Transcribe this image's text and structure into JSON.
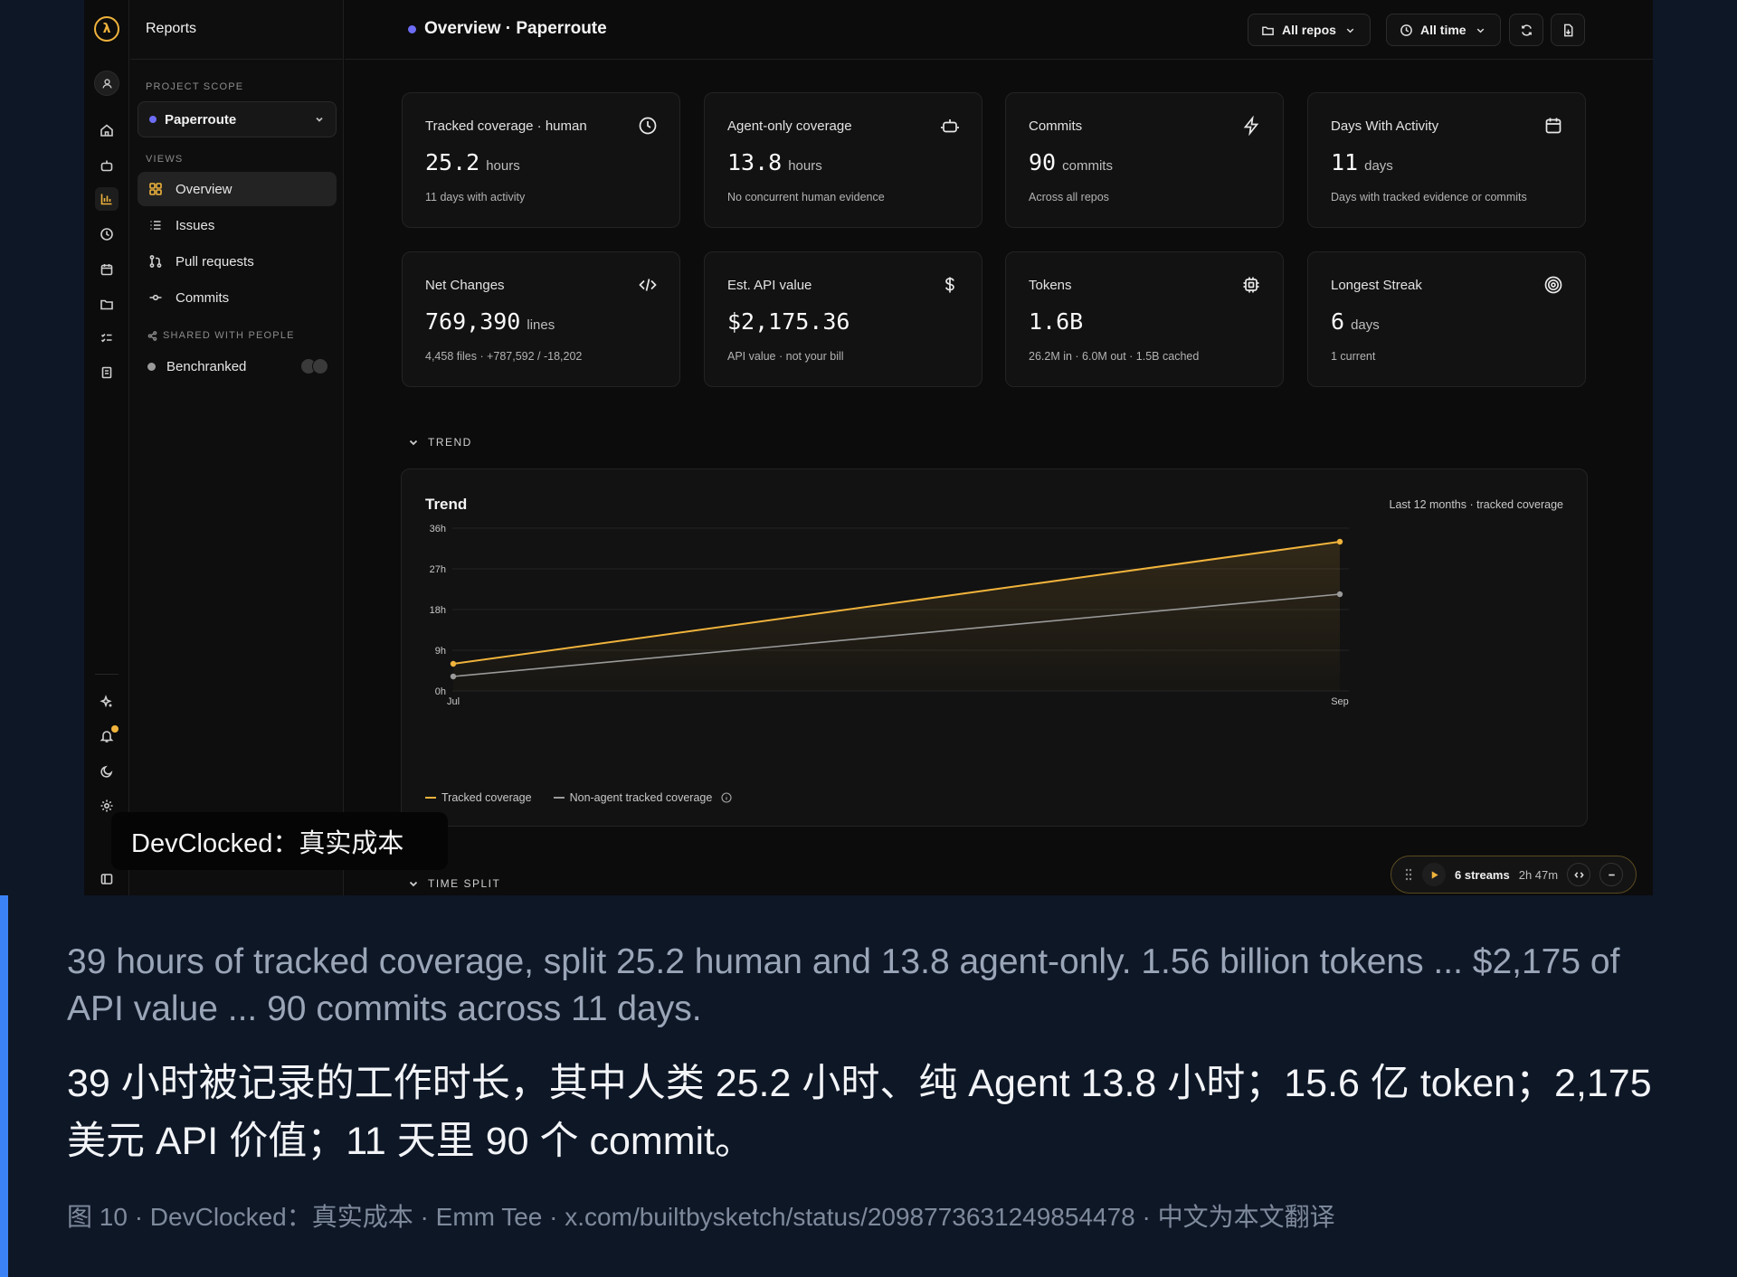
{
  "app": {
    "sidebar_title": "Reports",
    "scope_caption": "PROJECT SCOPE",
    "scope_value": "Paperroute",
    "views_caption": "VIEWS",
    "nav": [
      {
        "label": "Overview",
        "icon": "grid-icon",
        "active": true
      },
      {
        "label": "Issues",
        "icon": "list-icon"
      },
      {
        "label": "Pull requests",
        "icon": "git-pull-request-icon"
      },
      {
        "label": "Commits",
        "icon": "git-commit-icon"
      }
    ],
    "shared_caption": "SHARED WITH PEOPLE",
    "shared_items": [
      {
        "label": "Benchranked"
      }
    ],
    "page_title": "Overview · Paperroute",
    "filters": {
      "repos": "All repos",
      "time": "All time"
    },
    "accent": "#f0b33c",
    "brand_dot": "#6c6cf4"
  },
  "cards": [
    {
      "label": "Tracked coverage · human",
      "value": "25.2",
      "unit": "hours",
      "sub": "11 days with activity",
      "icon": "clock-icon"
    },
    {
      "label": "Agent-only coverage",
      "value": "13.8",
      "unit": "hours",
      "sub": "No concurrent human evidence",
      "icon": "bot-icon"
    },
    {
      "label": "Commits",
      "value": "90",
      "unit": "commits",
      "sub": "Across all repos",
      "icon": "zap-icon"
    },
    {
      "label": "Days With Activity",
      "value": "11",
      "unit": "days",
      "sub": "Days with tracked evidence or commits",
      "icon": "calendar-icon"
    },
    {
      "label": "Net Changes",
      "value": "769,390",
      "unit": "lines",
      "sub": "4,458 files · +787,592 / -18,202",
      "icon": "code-icon"
    },
    {
      "label": "Est. API value",
      "value": "$2,175.36",
      "unit": "",
      "sub": "API value · not your bill",
      "icon": "dollar-icon"
    },
    {
      "label": "Tokens",
      "value": "1.6B",
      "unit": "",
      "sub": "26.2M in · 6.0M out · 1.5B cached",
      "icon": "cpu-icon"
    },
    {
      "label": "Longest Streak",
      "value": "6",
      "unit": "days",
      "sub": "1 current",
      "icon": "target-icon"
    }
  ],
  "sections": {
    "trend": "TREND",
    "time_split": "TIME SPLIT"
  },
  "trend": {
    "title": "Trend",
    "subtitle": "Last 12 months · tracked coverage",
    "legend": [
      "Tracked coverage",
      "Non-agent tracked coverage"
    ]
  },
  "chart_data": {
    "type": "area",
    "x": [
      "Jul",
      "Sep"
    ],
    "yticks": [
      "36h",
      "27h",
      "18h",
      "9h",
      "0h"
    ],
    "ylim": [
      0,
      36
    ],
    "series": [
      {
        "name": "Tracked coverage",
        "values": [
          6,
          33
        ],
        "color": "#f0b33c"
      },
      {
        "name": "Non-agent tracked coverage",
        "values": [
          3.2,
          21.4
        ],
        "color": "#9a9a9a"
      }
    ],
    "grid": true,
    "legend_position": "bottom-left"
  },
  "streams": {
    "label": "6 streams",
    "time": "2h 47m"
  },
  "tooltip": "DevClocked：真实成本",
  "article": {
    "en": "39 hours of tracked coverage, split 25.2 human and 13.8 agent-only. 1.56 billion tokens ... $2,175 of API value ... 90 commits across 11 days.",
    "zh": "39 小时被记录的工作时长，其中人类 25.2 小时、纯 Agent 13.8 小时；15.6 亿 token；2,175 美元 API 价值；11 天里 90 个 commit。",
    "caption": "图 10 · DevClocked：真实成本 · Emm Tee · x.com/builtbysketch/status/2098773631249854478 · 中文为本文翻译"
  }
}
